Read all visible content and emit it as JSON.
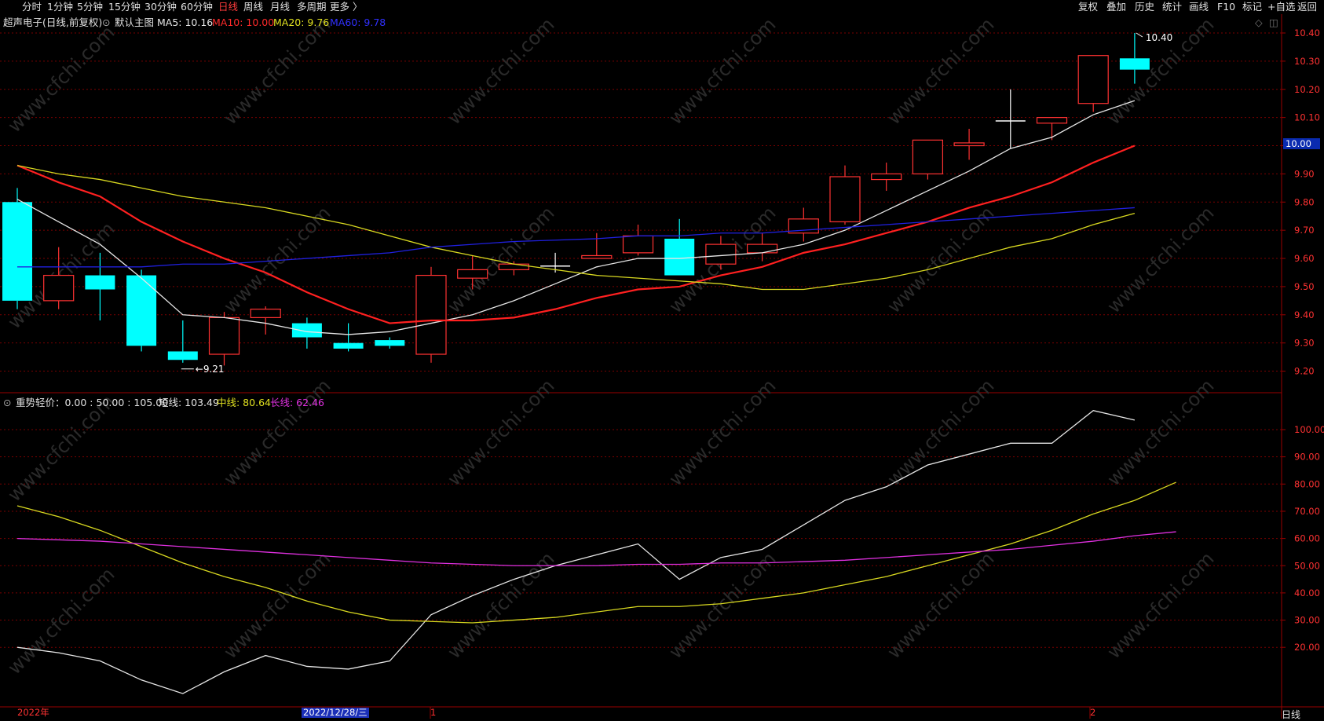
{
  "toolbar": {
    "left": [
      "分时",
      "1分钟",
      "5分钟",
      "15分钟",
      "30分钟",
      "60分钟",
      "日线",
      "周线",
      "月线",
      "多周期",
      "更多 〉"
    ],
    "active": "日线",
    "right": [
      "复权",
      "叠加",
      "历史",
      "统计",
      "画线",
      "F10",
      "标记",
      "+自选",
      "返回"
    ]
  },
  "main_info": {
    "title": "超声电子(日线,前复权)",
    "indicator": "默认主图",
    "ma5": "MA5: 10.16",
    "ma10": "MA10: 10.00",
    "ma20": "MA20: 9.76",
    "ma60": "MA60: 9.78"
  },
  "sub_info": {
    "name": "重势轻价：0.00 : 50.00 : 105.00",
    "short": "短线: 103.49",
    "mid": "中线: 80.64",
    "long": "长线: 62.46"
  },
  "current_price": "10.00",
  "date_axis": {
    "year": "2022年",
    "selected": "2022/12/28/三",
    "m1": "1",
    "m2": "2",
    "period": "日线"
  },
  "watermark": "www.cfchi.com",
  "colors": {
    "up": "#ff3232",
    "down": "#00ffff",
    "ma5": "#e6e6e6",
    "ma10": "#ff2020",
    "ma20": "#d8d820",
    "ma60": "#2020e0",
    "grid": "#7a0000",
    "bg": "#000000"
  },
  "chart_data": [
    {
      "type": "candlestick",
      "title": "超声电子(日线,前复权)",
      "y_ticks": [
        10.4,
        10.3,
        10.2,
        10.1,
        10.0,
        9.9,
        9.8,
        9.7,
        9.6,
        9.5,
        9.4,
        9.3,
        9.2
      ],
      "ylim": [
        9.17,
        10.44
      ],
      "annotations": {
        "high_label": "10.40",
        "low_label": "9.21"
      },
      "candles": [
        {
          "o": 9.8,
          "c": 9.45,
          "h": 9.85,
          "l": 9.42
        },
        {
          "o": 9.45,
          "c": 9.54,
          "h": 9.64,
          "l": 9.42
        },
        {
          "o": 9.54,
          "c": 9.49,
          "h": 9.62,
          "l": 9.38
        },
        {
          "o": 9.54,
          "c": 9.29,
          "h": 9.56,
          "l": 9.27
        },
        {
          "o": 9.27,
          "c": 9.24,
          "h": 9.38,
          "l": 9.23
        },
        {
          "o": 9.26,
          "c": 9.39,
          "h": 9.41,
          "l": 9.22
        },
        {
          "o": 9.39,
          "c": 9.42,
          "h": 9.43,
          "l": 9.33
        },
        {
          "o": 9.37,
          "c": 9.32,
          "h": 9.39,
          "l": 9.28
        },
        {
          "o": 9.3,
          "c": 9.28,
          "h": 9.37,
          "l": 9.27
        },
        {
          "o": 9.31,
          "c": 9.29,
          "h": 9.32,
          "l": 9.28
        },
        {
          "o": 9.26,
          "c": 9.54,
          "h": 9.57,
          "l": 9.23
        },
        {
          "o": 9.53,
          "c": 9.56,
          "h": 9.61,
          "l": 9.49
        },
        {
          "o": 9.56,
          "c": 9.58,
          "h": 9.59,
          "l": 9.54
        },
        {
          "o": 9.575,
          "c": 9.575,
          "h": 9.62,
          "l": 9.55
        },
        {
          "o": 9.6,
          "c": 9.61,
          "h": 9.69,
          "l": 9.6
        },
        {
          "o": 9.62,
          "c": 9.68,
          "h": 9.72,
          "l": 9.61
        },
        {
          "o": 9.67,
          "c": 9.54,
          "h": 9.74,
          "l": 9.54
        },
        {
          "o": 9.58,
          "c": 9.65,
          "h": 9.68,
          "l": 9.56
        },
        {
          "o": 9.62,
          "c": 9.65,
          "h": 9.69,
          "l": 9.59
        },
        {
          "o": 9.69,
          "c": 9.74,
          "h": 9.78,
          "l": 9.66
        },
        {
          "o": 9.73,
          "c": 9.89,
          "h": 9.93,
          "l": 9.72
        },
        {
          "o": 9.88,
          "c": 9.9,
          "h": 9.94,
          "l": 9.84
        },
        {
          "o": 9.9,
          "c": 10.02,
          "h": 10.02,
          "l": 9.88
        },
        {
          "o": 10.0,
          "c": 10.01,
          "h": 10.06,
          "l": 9.95
        },
        {
          "o": 10.09,
          "c": 10.09,
          "h": 10.2,
          "l": 9.99
        },
        {
          "o": 10.08,
          "c": 10.1,
          "h": 10.1,
          "l": 10.02
        },
        {
          "o": 10.15,
          "c": 10.32,
          "h": 10.32,
          "l": 10.12
        },
        {
          "o": 10.31,
          "c": 10.27,
          "h": 10.4,
          "l": 10.22
        }
      ],
      "series": [
        {
          "name": "MA5",
          "values": [
            9.81,
            9.73,
            9.65,
            9.53,
            9.4,
            9.39,
            9.37,
            9.34,
            9.33,
            9.34,
            9.37,
            9.4,
            9.45,
            9.51,
            9.57,
            9.6,
            9.6,
            9.61,
            9.62,
            9.65,
            9.7,
            9.77,
            9.84,
            9.91,
            9.99,
            10.03,
            10.11,
            10.16
          ]
        },
        {
          "name": "MA10",
          "values": [
            9.93,
            9.87,
            9.82,
            9.73,
            9.66,
            9.6,
            9.55,
            9.48,
            9.42,
            9.37,
            9.38,
            9.38,
            9.39,
            9.42,
            9.46,
            9.49,
            9.5,
            9.54,
            9.57,
            9.62,
            9.65,
            9.69,
            9.73,
            9.78,
            9.82,
            9.87,
            9.94,
            10.0
          ]
        },
        {
          "name": "MA20",
          "values": [
            9.93,
            9.9,
            9.88,
            9.85,
            9.82,
            9.8,
            9.78,
            9.75,
            9.72,
            9.68,
            9.64,
            9.61,
            9.58,
            9.56,
            9.54,
            9.53,
            9.52,
            9.51,
            9.49,
            9.49,
            9.51,
            9.53,
            9.56,
            9.6,
            9.64,
            9.67,
            9.72,
            9.76
          ]
        },
        {
          "name": "MA60",
          "values": [
            9.57,
            9.57,
            9.57,
            9.57,
            9.58,
            9.58,
            9.59,
            9.6,
            9.61,
            9.62,
            9.64,
            9.65,
            9.66,
            9.665,
            9.67,
            9.68,
            9.68,
            9.69,
            9.69,
            9.7,
            9.71,
            9.72,
            9.73,
            9.74,
            9.75,
            9.76,
            9.77,
            9.78
          ]
        }
      ]
    },
    {
      "type": "line",
      "title": "重势轻价",
      "y_ticks": [
        100,
        90,
        80,
        70,
        60,
        50,
        40,
        30,
        20
      ],
      "ylim": [
        2,
        110
      ],
      "series": [
        {
          "name": "短线",
          "values": [
            20,
            18,
            15,
            8,
            3,
            11,
            17,
            13,
            12,
            15,
            32,
            39,
            45,
            50,
            54,
            58,
            45,
            53,
            56,
            65,
            74,
            79,
            87,
            91,
            95,
            95,
            107,
            103.49
          ]
        },
        {
          "name": "中线",
          "values": [
            72,
            68,
            63,
            57,
            51,
            46,
            42,
            37,
            33,
            30,
            29.5,
            29,
            30,
            31,
            33,
            35,
            35,
            36,
            38,
            40,
            43,
            46,
            50,
            54,
            58,
            63,
            69,
            74,
            80.64
          ]
        },
        {
          "name": "长线",
          "values": [
            60,
            59.5,
            59,
            58,
            57,
            56,
            55,
            54,
            53,
            52,
            51,
            50.5,
            50,
            50,
            50,
            50.5,
            50.5,
            51,
            51,
            51.5,
            52,
            53,
            54,
            55,
            56,
            57.5,
            59,
            61,
            62.46
          ]
        }
      ]
    }
  ]
}
